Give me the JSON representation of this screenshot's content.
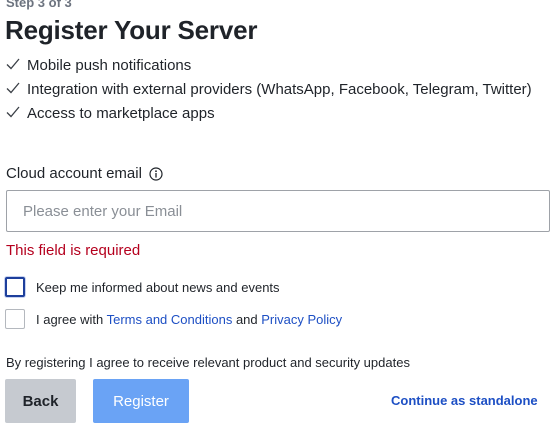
{
  "header": {
    "step": "Step 3 of 3",
    "title": "Register Your Server"
  },
  "features": [
    {
      "icon": "check-icon",
      "label": "Mobile push notifications"
    },
    {
      "icon": "check-icon",
      "label": "Integration with external providers (WhatsApp, Facebook, Telegram, Twitter)"
    },
    {
      "icon": "check-icon",
      "label": "Access to marketplace apps"
    }
  ],
  "email_field": {
    "label": "Cloud account email",
    "info_icon": "info-icon",
    "placeholder": "Please enter your Email",
    "value": "",
    "error": "This field is required"
  },
  "checkboxes": {
    "updates": {
      "label": "Keep me informed about news and events",
      "checked": false,
      "focused": true
    },
    "terms": {
      "prefix": "I agree with ",
      "terms_link": "Terms and Conditions",
      "conjunction": " and ",
      "privacy_link": "Privacy Policy",
      "checked": false
    }
  },
  "disclaimer": "By registering I agree to receive relevant product and security updates",
  "actions": {
    "back_label": "Back",
    "register_label": "Register",
    "standalone_label": "Continue as standalone"
  },
  "colors": {
    "error": "#b5001e",
    "link": "#1d4fc4",
    "primary_button": "#6aa3f5",
    "secondary_button": "#c6cad0"
  }
}
